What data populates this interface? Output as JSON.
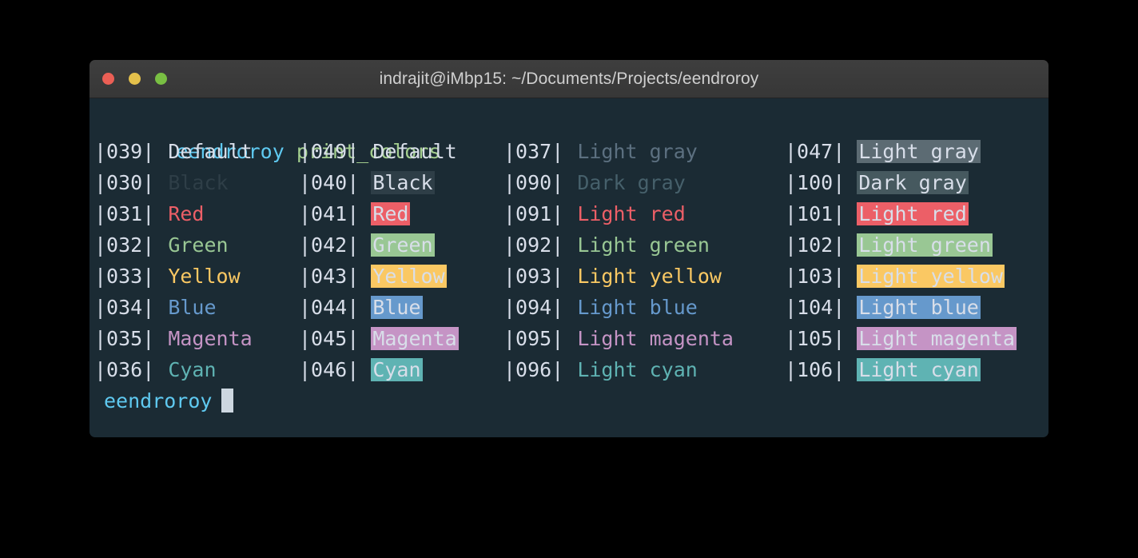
{
  "window": {
    "title": "indrajit@iMbp15: ~/Documents/Projects/eendroroy",
    "traffic_lights": [
      {
        "name": "close",
        "color": "#eb5f55"
      },
      {
        "name": "minimize",
        "color": "#e4c04b"
      },
      {
        "name": "zoom",
        "color": "#79bf43"
      }
    ]
  },
  "terminal": {
    "background": "#1b2b34",
    "command_line": {
      "prompt": "eendroroy",
      "command": " print_colors"
    },
    "prompt_line": {
      "prompt": "eendroroy",
      "cursor": "block"
    },
    "palette": {
      "default": "#d8dee9",
      "black": "#2e3e47",
      "red": "#ec5f67",
      "green": "#99c794",
      "yellow": "#fac863",
      "blue": "#6699cc",
      "magenta": "#c594c5",
      "cyan": "#5fb3b3",
      "light_gray": "#5c7080",
      "dark_gray": "#46606b",
      "bg_light_gray": "#5c6b73",
      "bg_dark_gray": "#46595f",
      "bg_black": "#2e3e47",
      "fg_on_bg": "#d8dee9"
    },
    "rows": [
      {
        "cells": [
          {
            "code": "|039| ",
            "label": "Default",
            "fg": "#d8dee9",
            "bg": "none"
          },
          {
            "code": "|049| ",
            "label": "Default",
            "fg": "#d8dee9",
            "bg": "none"
          },
          {
            "code": "|037| ",
            "label": "Light gray",
            "fg": "#5c7080",
            "bg": "none"
          },
          {
            "code": "|047| ",
            "label": "Light gray",
            "fg": "#d8dee9",
            "bg": "#5c6b73"
          }
        ]
      },
      {
        "cells": [
          {
            "code": "|030| ",
            "label": "Black",
            "fg": "#2e3e47",
            "bg": "none"
          },
          {
            "code": "|040| ",
            "label": "Black",
            "fg": "#d8dee9",
            "bg": "#2e3e47"
          },
          {
            "code": "|090| ",
            "label": "Dark gray",
            "fg": "#46606b",
            "bg": "none"
          },
          {
            "code": "|100| ",
            "label": "Dark gray",
            "fg": "#d8dee9",
            "bg": "#46595f"
          }
        ]
      },
      {
        "cells": [
          {
            "code": "|031| ",
            "label": "Red",
            "fg": "#ec5f67",
            "bg": "none"
          },
          {
            "code": "|041| ",
            "label": "Red",
            "fg": "#d8dee9",
            "bg": "#ec5f67"
          },
          {
            "code": "|091| ",
            "label": "Light red",
            "fg": "#ec5f67",
            "bg": "none"
          },
          {
            "code": "|101| ",
            "label": "Light red",
            "fg": "#d8dee9",
            "bg": "#ec5f67"
          }
        ]
      },
      {
        "cells": [
          {
            "code": "|032| ",
            "label": "Green",
            "fg": "#99c794",
            "bg": "none"
          },
          {
            "code": "|042| ",
            "label": "Green",
            "fg": "#d8dee9",
            "bg": "#99c794"
          },
          {
            "code": "|092| ",
            "label": "Light green",
            "fg": "#99c794",
            "bg": "none"
          },
          {
            "code": "|102| ",
            "label": "Light green",
            "fg": "#d8dee9",
            "bg": "#99c794"
          }
        ]
      },
      {
        "cells": [
          {
            "code": "|033| ",
            "label": "Yellow",
            "fg": "#fac863",
            "bg": "none"
          },
          {
            "code": "|043| ",
            "label": "Yellow",
            "fg": "#d8dee9",
            "bg": "#fac863"
          },
          {
            "code": "|093| ",
            "label": "Light yellow",
            "fg": "#fac863",
            "bg": "none"
          },
          {
            "code": "|103| ",
            "label": "Light yellow",
            "fg": "#d8dee9",
            "bg": "#fac863"
          }
        ]
      },
      {
        "cells": [
          {
            "code": "|034| ",
            "label": "Blue",
            "fg": "#6699cc",
            "bg": "none"
          },
          {
            "code": "|044| ",
            "label": "Blue",
            "fg": "#d8dee9",
            "bg": "#6699cc"
          },
          {
            "code": "|094| ",
            "label": "Light blue",
            "fg": "#6699cc",
            "bg": "none"
          },
          {
            "code": "|104| ",
            "label": "Light blue",
            "fg": "#d8dee9",
            "bg": "#6699cc"
          }
        ]
      },
      {
        "cells": [
          {
            "code": "|035| ",
            "label": "Magenta",
            "fg": "#c594c5",
            "bg": "none"
          },
          {
            "code": "|045| ",
            "label": "Magenta",
            "fg": "#d8dee9",
            "bg": "#c594c5"
          },
          {
            "code": "|095| ",
            "label": "Light magenta",
            "fg": "#c594c5",
            "bg": "none"
          },
          {
            "code": "|105| ",
            "label": "Light magenta",
            "fg": "#d8dee9",
            "bg": "#c594c5"
          }
        ]
      },
      {
        "cells": [
          {
            "code": "|036| ",
            "label": "Cyan",
            "fg": "#5fb3b3",
            "bg": "none"
          },
          {
            "code": "|046| ",
            "label": "Cyan",
            "fg": "#d8dee9",
            "bg": "#5fb3b3"
          },
          {
            "code": "|096| ",
            "label": "Light cyan",
            "fg": "#5fb3b3",
            "bg": "none"
          },
          {
            "code": "|106| ",
            "label": "Light cyan",
            "fg": "#d8dee9",
            "bg": "#5fb3b3"
          }
        ]
      }
    ]
  }
}
